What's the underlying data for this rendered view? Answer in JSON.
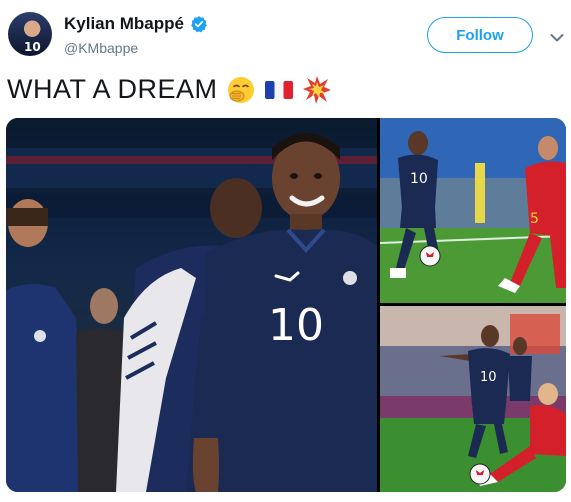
{
  "user": {
    "display_name": "Kylian Mbappé",
    "handle": "@KMbappe",
    "verified": true
  },
  "actions": {
    "follow_label": "Follow"
  },
  "tweet": {
    "text": "WHAT A DREAM",
    "emojis": [
      "hand-over-mouth-emoji",
      "france-flag-emoji",
      "collision-emoji"
    ]
  },
  "media": {
    "photo_count": 3,
    "main_jersey_number": "10",
    "top_right_jersey_number": "10",
    "bottom_right_jersey_number": "10",
    "top_right_opponent_number": "5"
  },
  "colors": {
    "accent": "#1da1f2",
    "text": "#14171a",
    "muted": "#657786",
    "france_blue": "#1b2a52",
    "belgium_red": "#d4202a"
  }
}
